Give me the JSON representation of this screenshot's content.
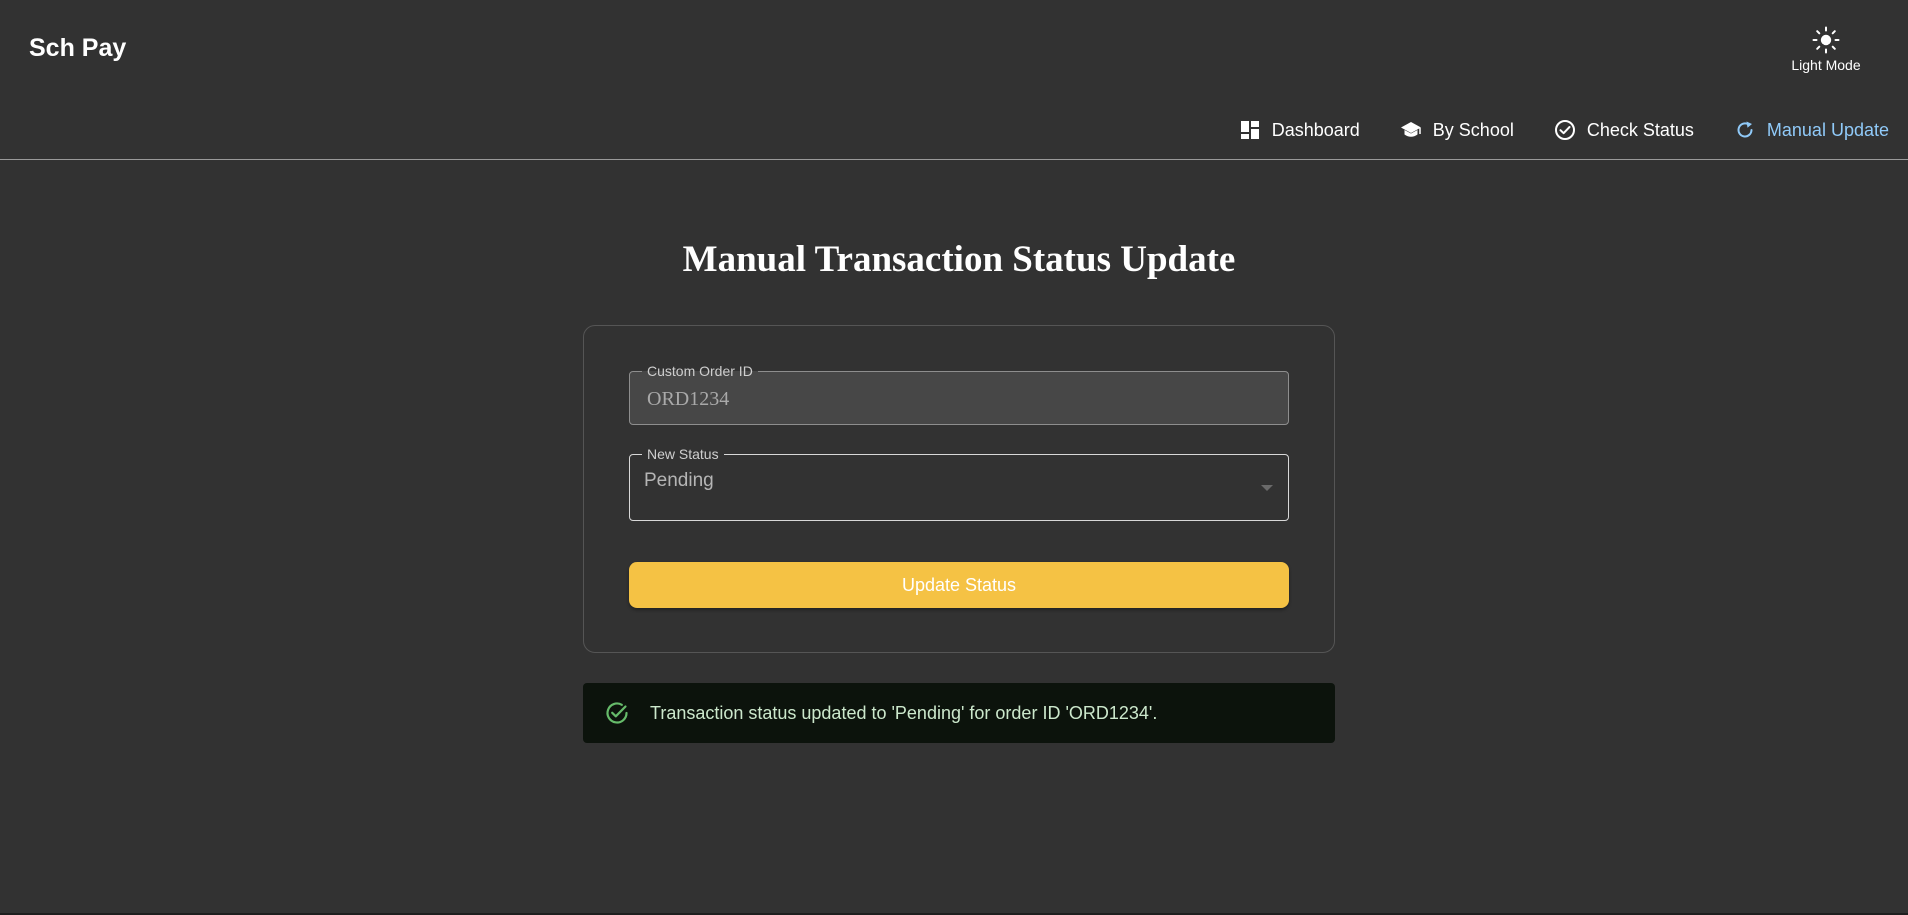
{
  "app": {
    "title": "Sch Pay"
  },
  "theme_toggle": {
    "label": "Light Mode",
    "icon": "sun-icon"
  },
  "nav": {
    "items": [
      {
        "label": "Dashboard",
        "icon": "dashboard-icon",
        "active": false
      },
      {
        "label": "By School",
        "icon": "school-icon",
        "active": false
      },
      {
        "label": "Check Status",
        "icon": "check-circle-icon",
        "active": false
      },
      {
        "label": "Manual Update",
        "icon": "refresh-icon",
        "active": true
      }
    ]
  },
  "page": {
    "title": "Manual Transaction Status Update"
  },
  "form": {
    "order_id": {
      "label": "Custom Order ID",
      "value": "ORD1234"
    },
    "status": {
      "label": "New Status",
      "selected": "Pending"
    },
    "submit_label": "Update Status"
  },
  "alert": {
    "message": "Transaction status updated to 'Pending' for order ID 'ORD1234'.",
    "icon": "success-check-icon"
  },
  "colors": {
    "background": "#323232",
    "accent_button": "#f5c244",
    "active_nav": "#90caf9",
    "success_icon": "#66bb6a",
    "alert_background": "#0c130c"
  }
}
